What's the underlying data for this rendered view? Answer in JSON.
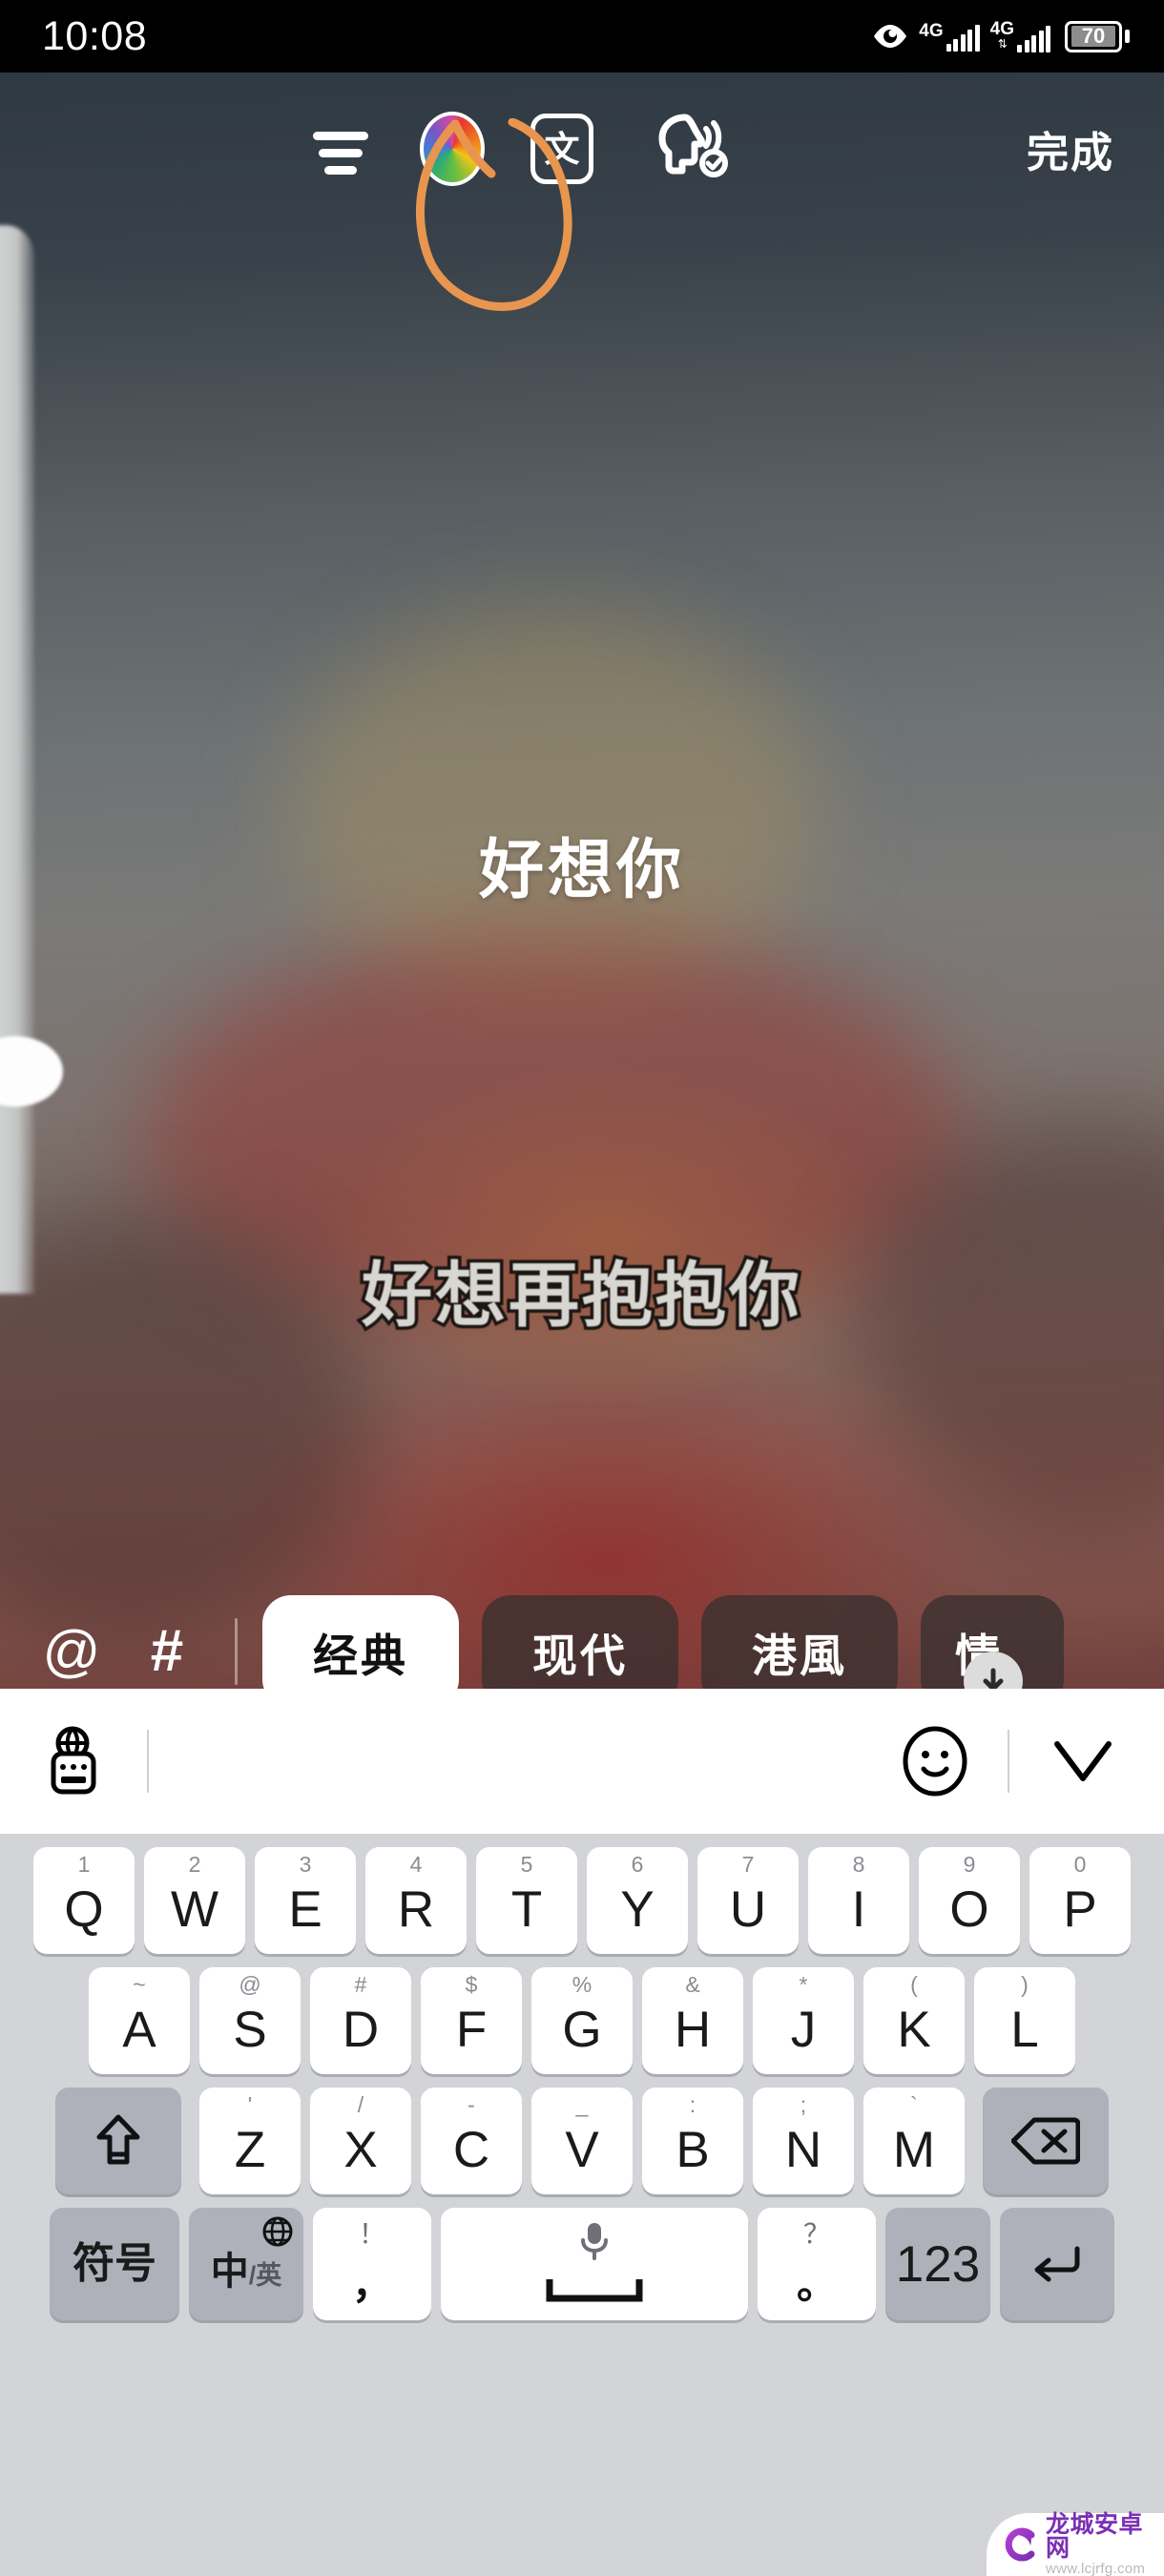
{
  "status_bar": {
    "time": "10:08",
    "eye_icon": "eye-icon",
    "network_1": {
      "label": "4G",
      "signal_bars": 5
    },
    "network_2": {
      "label": "4G",
      "arrows": "⇅",
      "signal_bars": 5
    },
    "battery": {
      "level": "70"
    }
  },
  "toolbar": {
    "menu_icon": "hamburger-menu-icon",
    "color_icon": "color-wheel-icon",
    "translate_label": "文",
    "voice_icon": "speech-head-icon",
    "done_label": "完成"
  },
  "annotation": {
    "shape": "hand-drawn-circle",
    "color": "#e8954f",
    "targets": "voice-button"
  },
  "canvas": {
    "text_line_1": "好想你",
    "text_line_2": "好想再抱抱你"
  },
  "chipbar": {
    "at_icon": "@",
    "hash_icon": "#",
    "chips": [
      {
        "label": "经典",
        "selected": true
      },
      {
        "label": "现代",
        "selected": false
      },
      {
        "label": "港風",
        "selected": false
      },
      {
        "label": "情",
        "selected": false
      }
    ],
    "download_badge": "download-arrow-icon"
  },
  "keyboard": {
    "toolbar": {
      "globe_keyboard_icon": "globe-keyboard-icon",
      "emoji_icon": "smiley-icon",
      "collapse_icon": "chevron-down-icon"
    },
    "row1": [
      {
        "sup": "1",
        "main": "Q"
      },
      {
        "sup": "2",
        "main": "W"
      },
      {
        "sup": "3",
        "main": "E"
      },
      {
        "sup": "4",
        "main": "R"
      },
      {
        "sup": "5",
        "main": "T"
      },
      {
        "sup": "6",
        "main": "Y"
      },
      {
        "sup": "7",
        "main": "U"
      },
      {
        "sup": "8",
        "main": "I"
      },
      {
        "sup": "9",
        "main": "O"
      },
      {
        "sup": "0",
        "main": "P"
      }
    ],
    "row2": [
      {
        "sup": "~",
        "main": "A"
      },
      {
        "sup": "@",
        "main": "S"
      },
      {
        "sup": "#",
        "main": "D"
      },
      {
        "sup": "$",
        "main": "F"
      },
      {
        "sup": "%",
        "main": "G"
      },
      {
        "sup": "&",
        "main": "H"
      },
      {
        "sup": "*",
        "main": "J"
      },
      {
        "sup": "(",
        "main": "K"
      },
      {
        "sup": ")",
        "main": "L"
      }
    ],
    "row3": {
      "shift_icon": "shift-arrow-icon",
      "keys": [
        {
          "sup": "'",
          "main": "Z"
        },
        {
          "sup": "/",
          "main": "X"
        },
        {
          "sup": "-",
          "main": "C"
        },
        {
          "sup": "_",
          "main": "V"
        },
        {
          "sup": ":",
          "main": "B"
        },
        {
          "sup": ";",
          "main": "N"
        },
        {
          "sup": "`",
          "main": "M"
        }
      ],
      "backspace_icon": "backspace-icon"
    },
    "row4": {
      "symbols_label": "符号",
      "lang_label": "中",
      "lang_label_sub": "/英",
      "lang_globe_icon": "globe-icon",
      "comma_top": "！",
      "comma_bottom": "，",
      "space_mic_icon": "microphone-icon",
      "space_icon": "spacebar-icon",
      "period_top": "？",
      "period_bottom": "。",
      "num_label": "123",
      "enter_icon": "enter-return-icon"
    }
  },
  "watermark": {
    "logo": "dragon-c-logo",
    "name": "龙城安卓网",
    "url": "www.lcjrfg.com"
  }
}
